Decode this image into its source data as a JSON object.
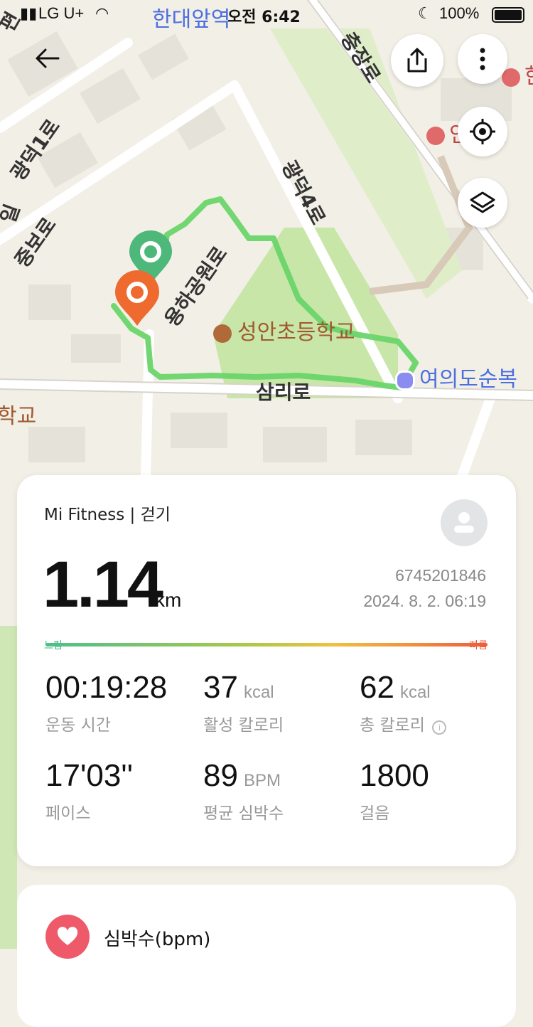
{
  "status_bar": {
    "carrier": "LG U+",
    "time": "오전 6:42",
    "battery": "100%",
    "station_label": "한대앞역"
  },
  "map": {
    "labels": {
      "jungjang": "충장로",
      "gwangdeok1": "광덕1로",
      "gwangdeok4": "광덕4로",
      "jungbo": "중보로",
      "yongha": "용하공원로",
      "school": "성안초등학교",
      "samri": "삼리로",
      "yeouido": "여의도순복",
      "school_left": "학교",
      "right_poi": "인트튼",
      "right_top_poi": "한",
      "edge_il": "일",
      "edge_pyeon": "편"
    },
    "colors": {
      "route": "#6ad56a",
      "start_pin": "#4db87a",
      "end_pin": "#ee6a2e",
      "park": "#c8e6a8",
      "road": "#ffffff",
      "block": "#e5e2da"
    }
  },
  "controls": {
    "back_icon": "back-arrow",
    "share_icon": "share",
    "more_icon": "more-vertical",
    "locate_icon": "crosshair",
    "layers_icon": "layers"
  },
  "summary": {
    "source": "Mi Fitness | 걷기",
    "distance": "1.14",
    "distance_unit": "km",
    "record_id": "6745201846",
    "date": "2024. 8. 2. 06:19",
    "pace_bar_low": "느림",
    "pace_bar_high": "빠름",
    "stats": [
      {
        "value": "00:19:28",
        "unit": "",
        "label": "운동 시간"
      },
      {
        "value": "37",
        "unit": "kcal",
        "label": "활성 칼로리"
      },
      {
        "value": "62",
        "unit": "kcal",
        "label": "총 칼로리"
      },
      {
        "value": "17'03''",
        "unit": "",
        "label": "페이스"
      },
      {
        "value": "89",
        "unit": "BPM",
        "label": "평균 심박수"
      },
      {
        "value": "1800",
        "unit": "",
        "label": "걸음"
      }
    ]
  },
  "heart_rate": {
    "title": "심박수(bpm)"
  }
}
